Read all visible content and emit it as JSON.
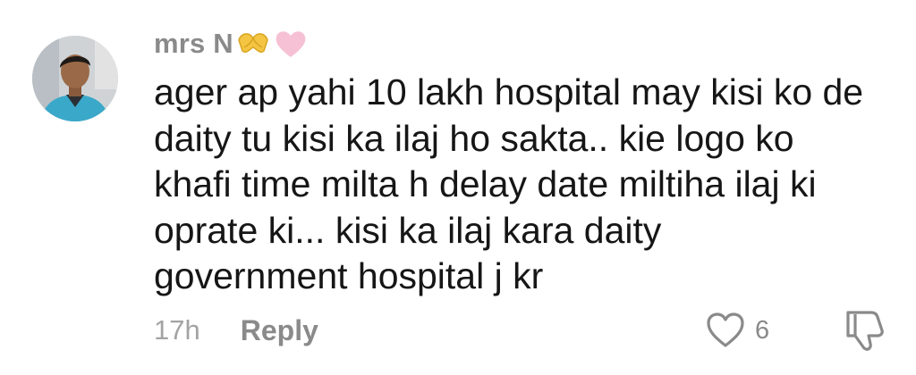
{
  "comment": {
    "username": "mrs N",
    "username_emojis": [
      "heart-hands-icon",
      "pink-heart-icon"
    ],
    "text": "ager ap yahi 10 lakh hospital may kisi ko de\ndaity tu kisi ka ilaj ho sakta.. kie logo ko\nkhafi time milta h delay date miltiha ilaj ki\noprate ki... kisi ka ilaj kara daity\ngovernment hospital j kr",
    "timestamp": "17h",
    "reply_label": "Reply",
    "like_count": "6",
    "icons": {
      "like": "heart-outline-icon",
      "dislike": "thumbs-down-icon"
    }
  },
  "colors": {
    "username": "#8a8a8a",
    "text": "#161616",
    "meta": "#a3a3a3",
    "heart_emoji": "#f6c1d4",
    "heart_hands": "#f4c542"
  }
}
